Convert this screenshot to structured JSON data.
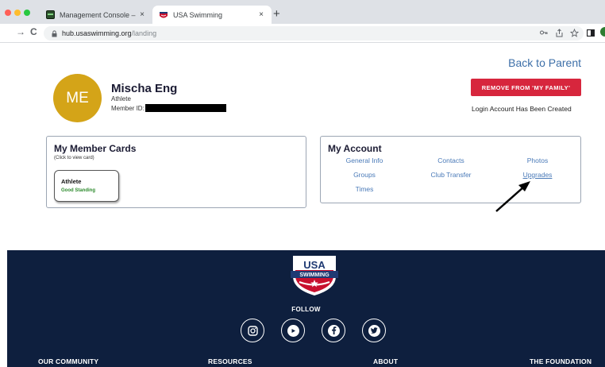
{
  "browser": {
    "tabs": [
      {
        "title": "Management Console – Grosse",
        "active": false
      },
      {
        "title": "USA Swimming",
        "active": true
      }
    ],
    "close_glyph": "×",
    "new_tab_glyph": "+",
    "url_domain": "hub.usaswimming.org",
    "url_path": "/landing",
    "nav": {
      "back": "→",
      "reload": "C"
    },
    "icons": [
      "key-icon",
      "share-icon",
      "star-icon",
      "sidebar-icon"
    ]
  },
  "page": {
    "back_link": "Back to Parent",
    "member": {
      "initials": "ME",
      "name": "Mischa Eng",
      "role": "Athlete",
      "id_label": "Member ID:",
      "id_value": ""
    },
    "remove_button": "REMOVE FROM 'MY FAMILY'",
    "login_status": "Login Account Has Been Created",
    "member_cards": {
      "title": "My Member Cards",
      "subtitle": "(Click to view card)",
      "card": {
        "type": "Athlete",
        "status": "Good Standing"
      }
    },
    "my_account": {
      "title": "My Account",
      "links": [
        "General Info",
        "Contacts",
        "Photos",
        "Groups",
        "Club Transfer",
        "Upgrades",
        "Times"
      ]
    }
  },
  "footer": {
    "logo_text": {
      "top": "USA",
      "bottom": "SWIMMING"
    },
    "follow": "FOLLOW",
    "social": [
      "instagram-icon",
      "youtube-icon",
      "facebook-icon",
      "twitter-icon"
    ],
    "columns": [
      "OUR COMMUNITY",
      "RESOURCES",
      "ABOUT",
      "THE FOUNDATION"
    ]
  },
  "colors": {
    "accent_red": "#d7263d",
    "avatar_gold": "#d4a418",
    "link_blue": "#4a7ab8",
    "footer_navy": "#0e1f3e",
    "good_standing_green": "#2e8b2e"
  }
}
